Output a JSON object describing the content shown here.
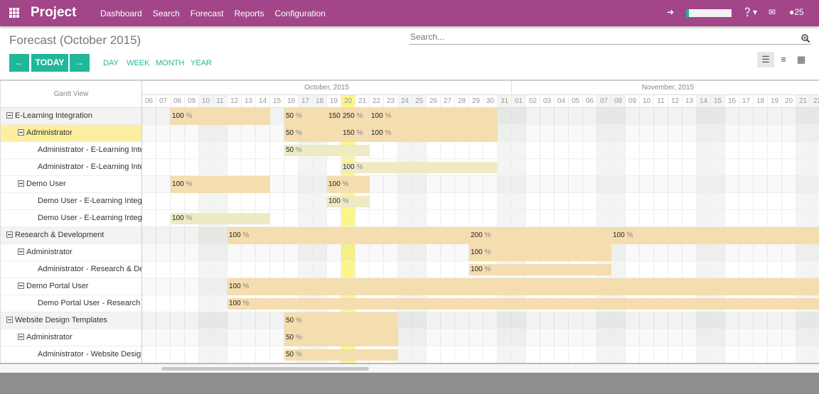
{
  "topbar": {
    "brand": "Project",
    "menu": [
      "Dashboard",
      "Search",
      "Forecast",
      "Reports",
      "Configuration"
    ],
    "messages_count": "25",
    "color": "#a24689"
  },
  "page": {
    "title": "Forecast (October 2015)"
  },
  "search": {
    "placeholder": "Search..."
  },
  "nav": {
    "prev": "←",
    "today": "TODAY",
    "next": "→",
    "scales": [
      "DAY",
      "WEEK",
      "MONTH",
      "YEAR"
    ],
    "accent": "#21b799"
  },
  "gantt": {
    "header": "Gantt View",
    "today": "2015-10-20",
    "months": [
      {
        "label": "October, 2015",
        "days": [
          "06",
          "07",
          "08",
          "09",
          "10",
          "11",
          "12",
          "13",
          "14",
          "15",
          "16",
          "17",
          "18",
          "19",
          "20",
          "21",
          "22",
          "23",
          "24",
          "25",
          "26",
          "27",
          "28",
          "29",
          "30",
          "31"
        ]
      },
      {
        "label": "November, 2015",
        "days": [
          "01",
          "02",
          "03",
          "04",
          "05",
          "06",
          "07",
          "08",
          "09",
          "10",
          "11",
          "12",
          "13",
          "14",
          "15",
          "16",
          "17",
          "18",
          "19",
          "20",
          "21",
          "22"
        ]
      }
    ],
    "weekends": [
      "10",
      "11",
      "17",
      "18",
      "24",
      "25",
      "31",
      "N01",
      "N07",
      "N08",
      "N14",
      "N15",
      "N21",
      "N22"
    ],
    "rows": [
      {
        "label": "E-Learning Integration",
        "level": 0,
        "bars": [
          {
            "from": "O08",
            "to": "O14",
            "kind": "group",
            "labels": [
              {
                "at": "O08",
                "v": "100",
                "u": "%"
              }
            ]
          },
          {
            "from": "O16",
            "to": "O30",
            "kind": "group",
            "labels": [
              {
                "at": "O16",
                "v": "50",
                "u": "%"
              },
              {
                "at": "O19",
                "v": "150",
                "u": ""
              },
              {
                "at": "O20",
                "v": "250",
                "u": "%"
              },
              {
                "at": "O22",
                "v": "100",
                "u": "%"
              }
            ]
          }
        ]
      },
      {
        "label": "Administrator",
        "level": 1,
        "selected": true,
        "bars": [
          {
            "from": "O16",
            "to": "O30",
            "kind": "group",
            "labels": [
              {
                "at": "O16",
                "v": "50",
                "u": "%"
              },
              {
                "at": "O20",
                "v": "150",
                "u": "%"
              },
              {
                "at": "O22",
                "v": "100",
                "u": "%"
              }
            ]
          }
        ]
      },
      {
        "label": "Administrator - E-Learning Integ",
        "level": 2,
        "bars": [
          {
            "from": "O16",
            "to": "O21",
            "kind": "leaf",
            "labels": [
              {
                "at": "O16",
                "v": "50",
                "u": "%"
              }
            ]
          }
        ]
      },
      {
        "label": "Administrator - E-Learning Integ",
        "level": 2,
        "bars": [
          {
            "from": "O20",
            "to": "O30",
            "kind": "leaf",
            "labels": [
              {
                "at": "O20",
                "v": "100",
                "u": "%"
              }
            ]
          }
        ]
      },
      {
        "label": "Demo User",
        "level": 1,
        "bars": [
          {
            "from": "O08",
            "to": "O14",
            "kind": "group",
            "labels": [
              {
                "at": "O08",
                "v": "100",
                "u": "%"
              }
            ]
          },
          {
            "from": "O19",
            "to": "O21",
            "kind": "group",
            "labels": [
              {
                "at": "O19",
                "v": "100",
                "u": "%"
              }
            ]
          }
        ]
      },
      {
        "label": "Demo User - E-Learning Integra",
        "level": 2,
        "bars": [
          {
            "from": "O19",
            "to": "O21",
            "kind": "leaf",
            "labels": [
              {
                "at": "O19",
                "v": "100",
                "u": "%"
              }
            ]
          }
        ]
      },
      {
        "label": "Demo User - E-Learning Integra",
        "level": 2,
        "bars": [
          {
            "from": "O08",
            "to": "O14",
            "kind": "leaf",
            "labels": [
              {
                "at": "O08",
                "v": "100",
                "u": "%"
              }
            ]
          }
        ]
      },
      {
        "label": "Research & Development",
        "level": 0,
        "bars": [
          {
            "from": "O12",
            "to": "N22",
            "kind": "group",
            "labels": [
              {
                "at": "O12",
                "v": "100",
                "u": "%"
              },
              {
                "at": "O29",
                "v": "200",
                "u": "%"
              },
              {
                "at": "N08",
                "v": "100",
                "u": "%"
              }
            ]
          }
        ]
      },
      {
        "label": "Administrator",
        "level": 1,
        "bars": [
          {
            "from": "O29",
            "to": "N07",
            "kind": "group",
            "labels": [
              {
                "at": "O29",
                "v": "100",
                "u": "%"
              }
            ]
          }
        ]
      },
      {
        "label": "Administrator - Research & Deve",
        "level": 2,
        "bars": [
          {
            "from": "O29",
            "to": "N07",
            "kind": "leafo",
            "labels": [
              {
                "at": "O29",
                "v": "100",
                "u": "%"
              }
            ]
          }
        ]
      },
      {
        "label": "Demo Portal User",
        "level": 1,
        "bars": [
          {
            "from": "O12",
            "to": "N22",
            "kind": "group",
            "labels": [
              {
                "at": "O12",
                "v": "100",
                "u": "%"
              }
            ]
          }
        ]
      },
      {
        "label": "Demo Portal User - Research &",
        "level": 2,
        "bars": [
          {
            "from": "O12",
            "to": "N22",
            "kind": "leafo",
            "labels": [
              {
                "at": "O12",
                "v": "100",
                "u": "%"
              }
            ]
          }
        ]
      },
      {
        "label": "Website Design Templates",
        "level": 0,
        "bars": [
          {
            "from": "O16",
            "to": "O23",
            "kind": "group",
            "labels": [
              {
                "at": "O16",
                "v": "50",
                "u": "%"
              }
            ]
          }
        ]
      },
      {
        "label": "Administrator",
        "level": 1,
        "bars": [
          {
            "from": "O16",
            "to": "O23",
            "kind": "group",
            "labels": [
              {
                "at": "O16",
                "v": "50",
                "u": "%"
              }
            ]
          }
        ]
      },
      {
        "label": "Administrator - Website Design T",
        "level": 2,
        "bars": [
          {
            "from": "O16",
            "to": "O23",
            "kind": "leafo",
            "labels": [
              {
                "at": "O16",
                "v": "50",
                "u": "%"
              }
            ]
          }
        ]
      }
    ],
    "colors": {
      "group": "#f4ddaf",
      "leaf": "#eeeac4",
      "leafo": "#f4ddaf",
      "today": "#fbf68a",
      "weekend": "#f3f5f3"
    }
  }
}
